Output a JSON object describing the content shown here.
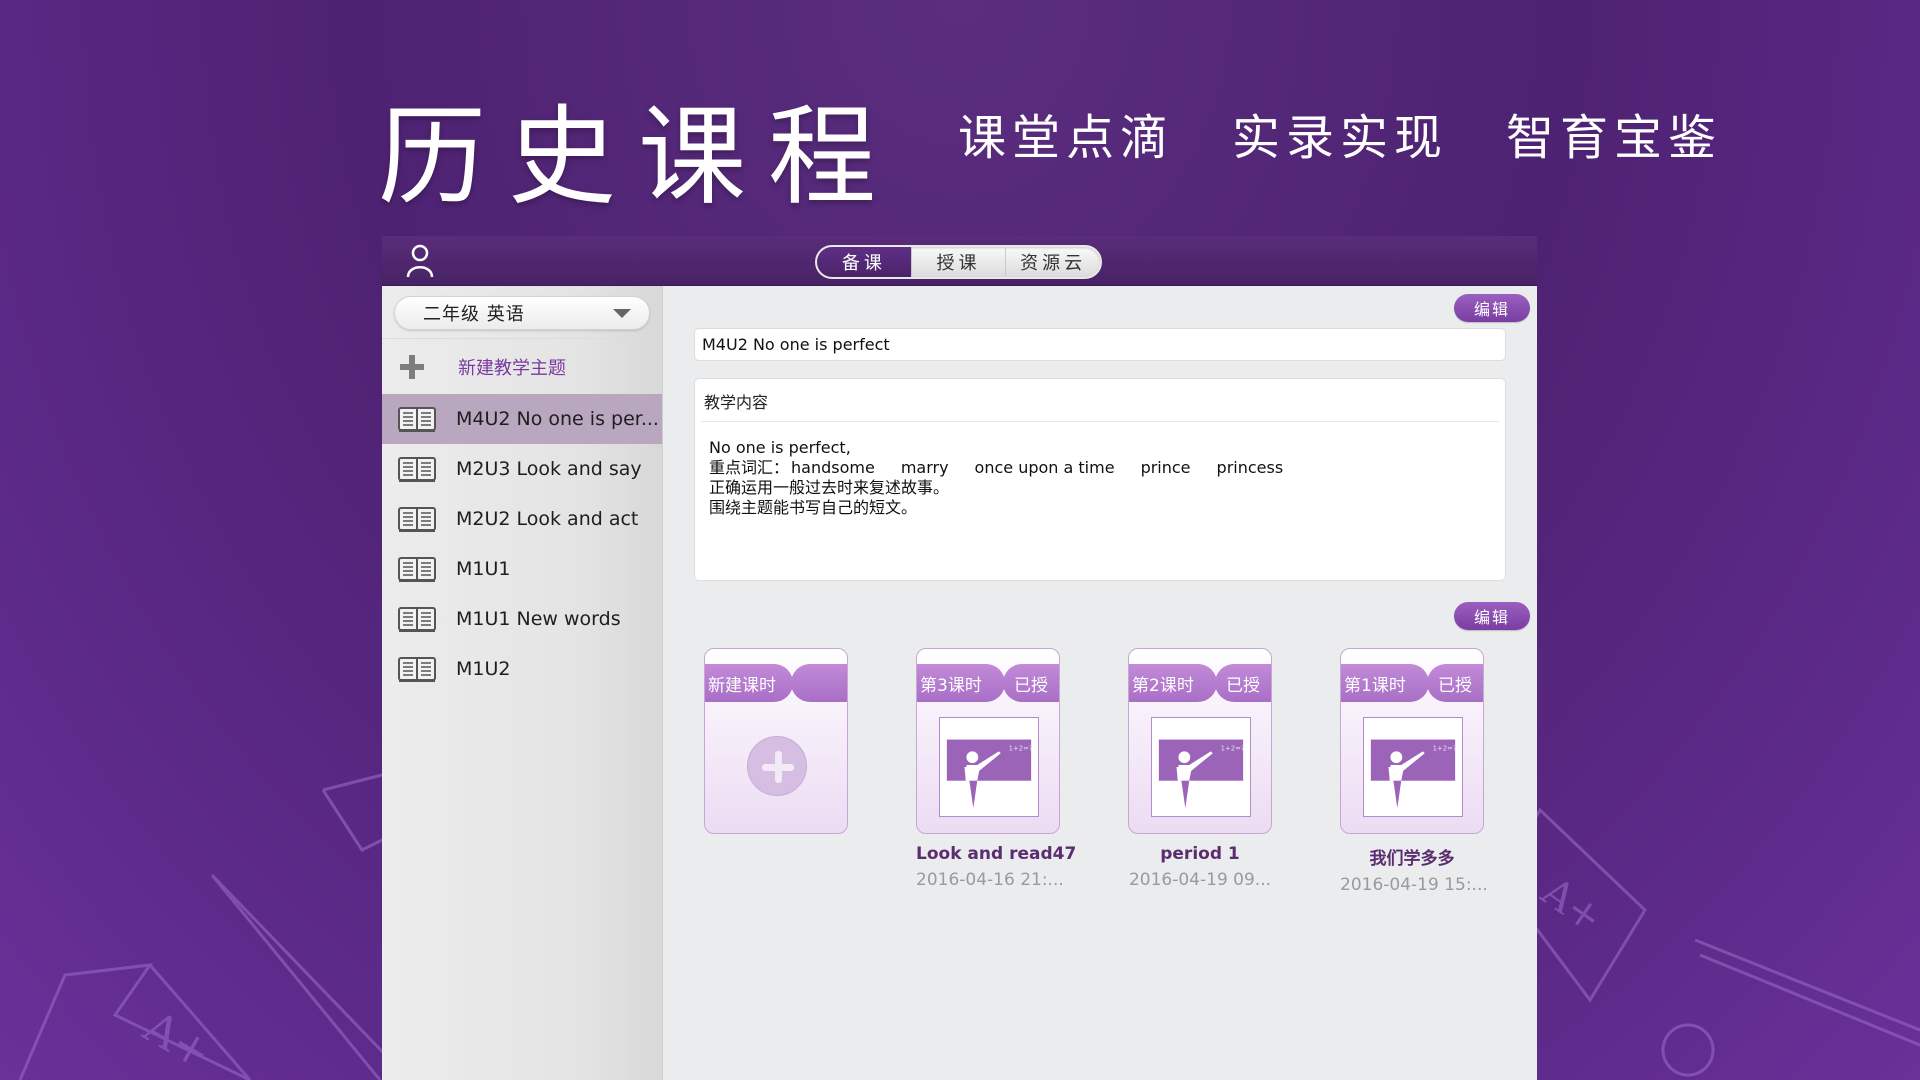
{
  "hero": {
    "title": "历史课程",
    "taglines": [
      "课堂点滴",
      "实录实现",
      "智育宝鉴"
    ]
  },
  "colors": {
    "brand_purple": "#5a2c7a",
    "accent_purple": "#9a5fbf",
    "card_header": "#b87ed0"
  },
  "app": {
    "header": {
      "user_icon": "user-icon",
      "tabs": [
        {
          "label": "备课",
          "active": true
        },
        {
          "label": "授课",
          "active": false
        },
        {
          "label": "资源云",
          "active": false
        }
      ]
    },
    "sidebar": {
      "grade_select": "二年级  英语",
      "new_topic_label": "新建教学主题",
      "topics": [
        {
          "label": "M4U2 No one is per...",
          "active": true
        },
        {
          "label": "M2U3 Look and say",
          "active": false
        },
        {
          "label": "M2U2 Look and act",
          "active": false
        },
        {
          "label": "M1U1",
          "active": false
        },
        {
          "label": "M1U1 New words",
          "active": false
        },
        {
          "label": "M1U2",
          "active": false
        }
      ]
    },
    "main": {
      "edit_label": "编辑",
      "topic_title": "M4U2 No one is perfect",
      "content_heading": "教学内容",
      "content_lines": {
        "line1": "No one is perfect,",
        "vocab_label": "重点词汇：",
        "vocab": [
          "handsome",
          "marry",
          "once upon a time",
          "prince",
          "princess"
        ],
        "line3": "正确运用一般过去时来复述故事。",
        "line4": "围绕主题能书写自己的短文。"
      },
      "lessons_edit_label": "编辑",
      "new_lesson_label": "新建课时",
      "lessons": [
        {
          "period": "第3课时",
          "status": "已授",
          "name": "Look and read47",
          "date": "2016-04-16 21:..."
        },
        {
          "period": "第2课时",
          "status": "已授",
          "name": "period 1",
          "date": "2016-04-19 09..."
        },
        {
          "period": "第1课时",
          "status": "已授",
          "name": "我们学多多",
          "date": "2016-04-19 15:..."
        }
      ]
    }
  }
}
